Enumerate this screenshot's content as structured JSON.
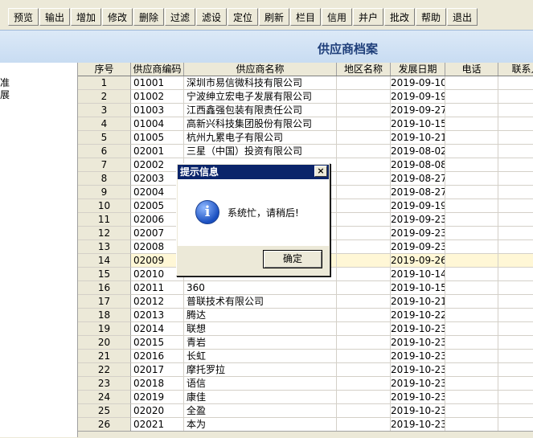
{
  "toolbar": {
    "items": [
      "预览",
      "输出",
      "增加",
      "修改",
      "删除",
      "过滤",
      "滤设",
      "定位",
      "刷新",
      "栏目",
      "信用",
      "并户",
      "批改",
      "帮助",
      "退出"
    ]
  },
  "page_title": "供应商档案",
  "left_tree": [
    "准",
    "展"
  ],
  "grid": {
    "headers": [
      "序号",
      "供应商编码",
      "供应商名称",
      "地区名称",
      "发展日期",
      "电话",
      "联系人"
    ],
    "rows": [
      {
        "seq": "1",
        "code": "01001",
        "name": "深圳市易信微科技有限公司",
        "date": "2019-09-10"
      },
      {
        "seq": "2",
        "code": "01002",
        "name": "宁波绅立宏电子发展有限公司",
        "date": "2019-09-19"
      },
      {
        "seq": "3",
        "code": "01003",
        "name": "江西鑫强包装有限责任公司",
        "date": "2019-09-27"
      },
      {
        "seq": "4",
        "code": "01004",
        "name": "高新兴科技集团股份有限公司",
        "date": "2019-10-15"
      },
      {
        "seq": "5",
        "code": "01005",
        "name": "杭州九累电子有限公司",
        "date": "2019-10-21"
      },
      {
        "seq": "6",
        "code": "02001",
        "name": "三星（中国）投资有限公司",
        "date": "2019-08-02"
      },
      {
        "seq": "7",
        "code": "02002",
        "name": "",
        "date": "2019-08-08"
      },
      {
        "seq": "8",
        "code": "02003",
        "name": "",
        "date": "2019-08-27"
      },
      {
        "seq": "9",
        "code": "02004",
        "name": "",
        "date": "2019-08-27"
      },
      {
        "seq": "10",
        "code": "02005",
        "name": "",
        "date": "2019-09-19"
      },
      {
        "seq": "11",
        "code": "02006",
        "name": "",
        "date": "2019-09-23"
      },
      {
        "seq": "12",
        "code": "02007",
        "name": "",
        "date": "2019-09-23"
      },
      {
        "seq": "13",
        "code": "02008",
        "name": "",
        "date": "2019-09-23"
      },
      {
        "seq": "14",
        "code": "02009",
        "name": "",
        "date": "2019-09-26"
      },
      {
        "seq": "15",
        "code": "02010",
        "name": "",
        "date": "2019-10-14"
      },
      {
        "seq": "16",
        "code": "02011",
        "name": "360",
        "date": "2019-10-15"
      },
      {
        "seq": "17",
        "code": "02012",
        "name": "普联技术有限公司",
        "date": "2019-10-21"
      },
      {
        "seq": "18",
        "code": "02013",
        "name": "腾达",
        "date": "2019-10-22"
      },
      {
        "seq": "19",
        "code": "02014",
        "name": "联想",
        "date": "2019-10-23"
      },
      {
        "seq": "20",
        "code": "02015",
        "name": "青岩",
        "date": "2019-10-23"
      },
      {
        "seq": "21",
        "code": "02016",
        "name": "长虹",
        "date": "2019-10-23"
      },
      {
        "seq": "22",
        "code": "02017",
        "name": "摩托罗拉",
        "date": "2019-10-23"
      },
      {
        "seq": "23",
        "code": "02018",
        "name": "语信",
        "date": "2019-10-23"
      },
      {
        "seq": "24",
        "code": "02019",
        "name": "康佳",
        "date": "2019-10-23"
      },
      {
        "seq": "25",
        "code": "02020",
        "name": "全盈",
        "date": "2019-10-23"
      },
      {
        "seq": "26",
        "code": "02021",
        "name": "本为",
        "date": "2019-10-23"
      }
    ],
    "highlighted_row": "14"
  },
  "dialog": {
    "title": "提示信息",
    "message": "系统忙，请稍后!",
    "ok_label": "确定",
    "close_glyph": "×",
    "icon_glyph": "i"
  },
  "colors": {
    "title_bar": "#0a246a",
    "highlight_row": "#fff7d6"
  }
}
